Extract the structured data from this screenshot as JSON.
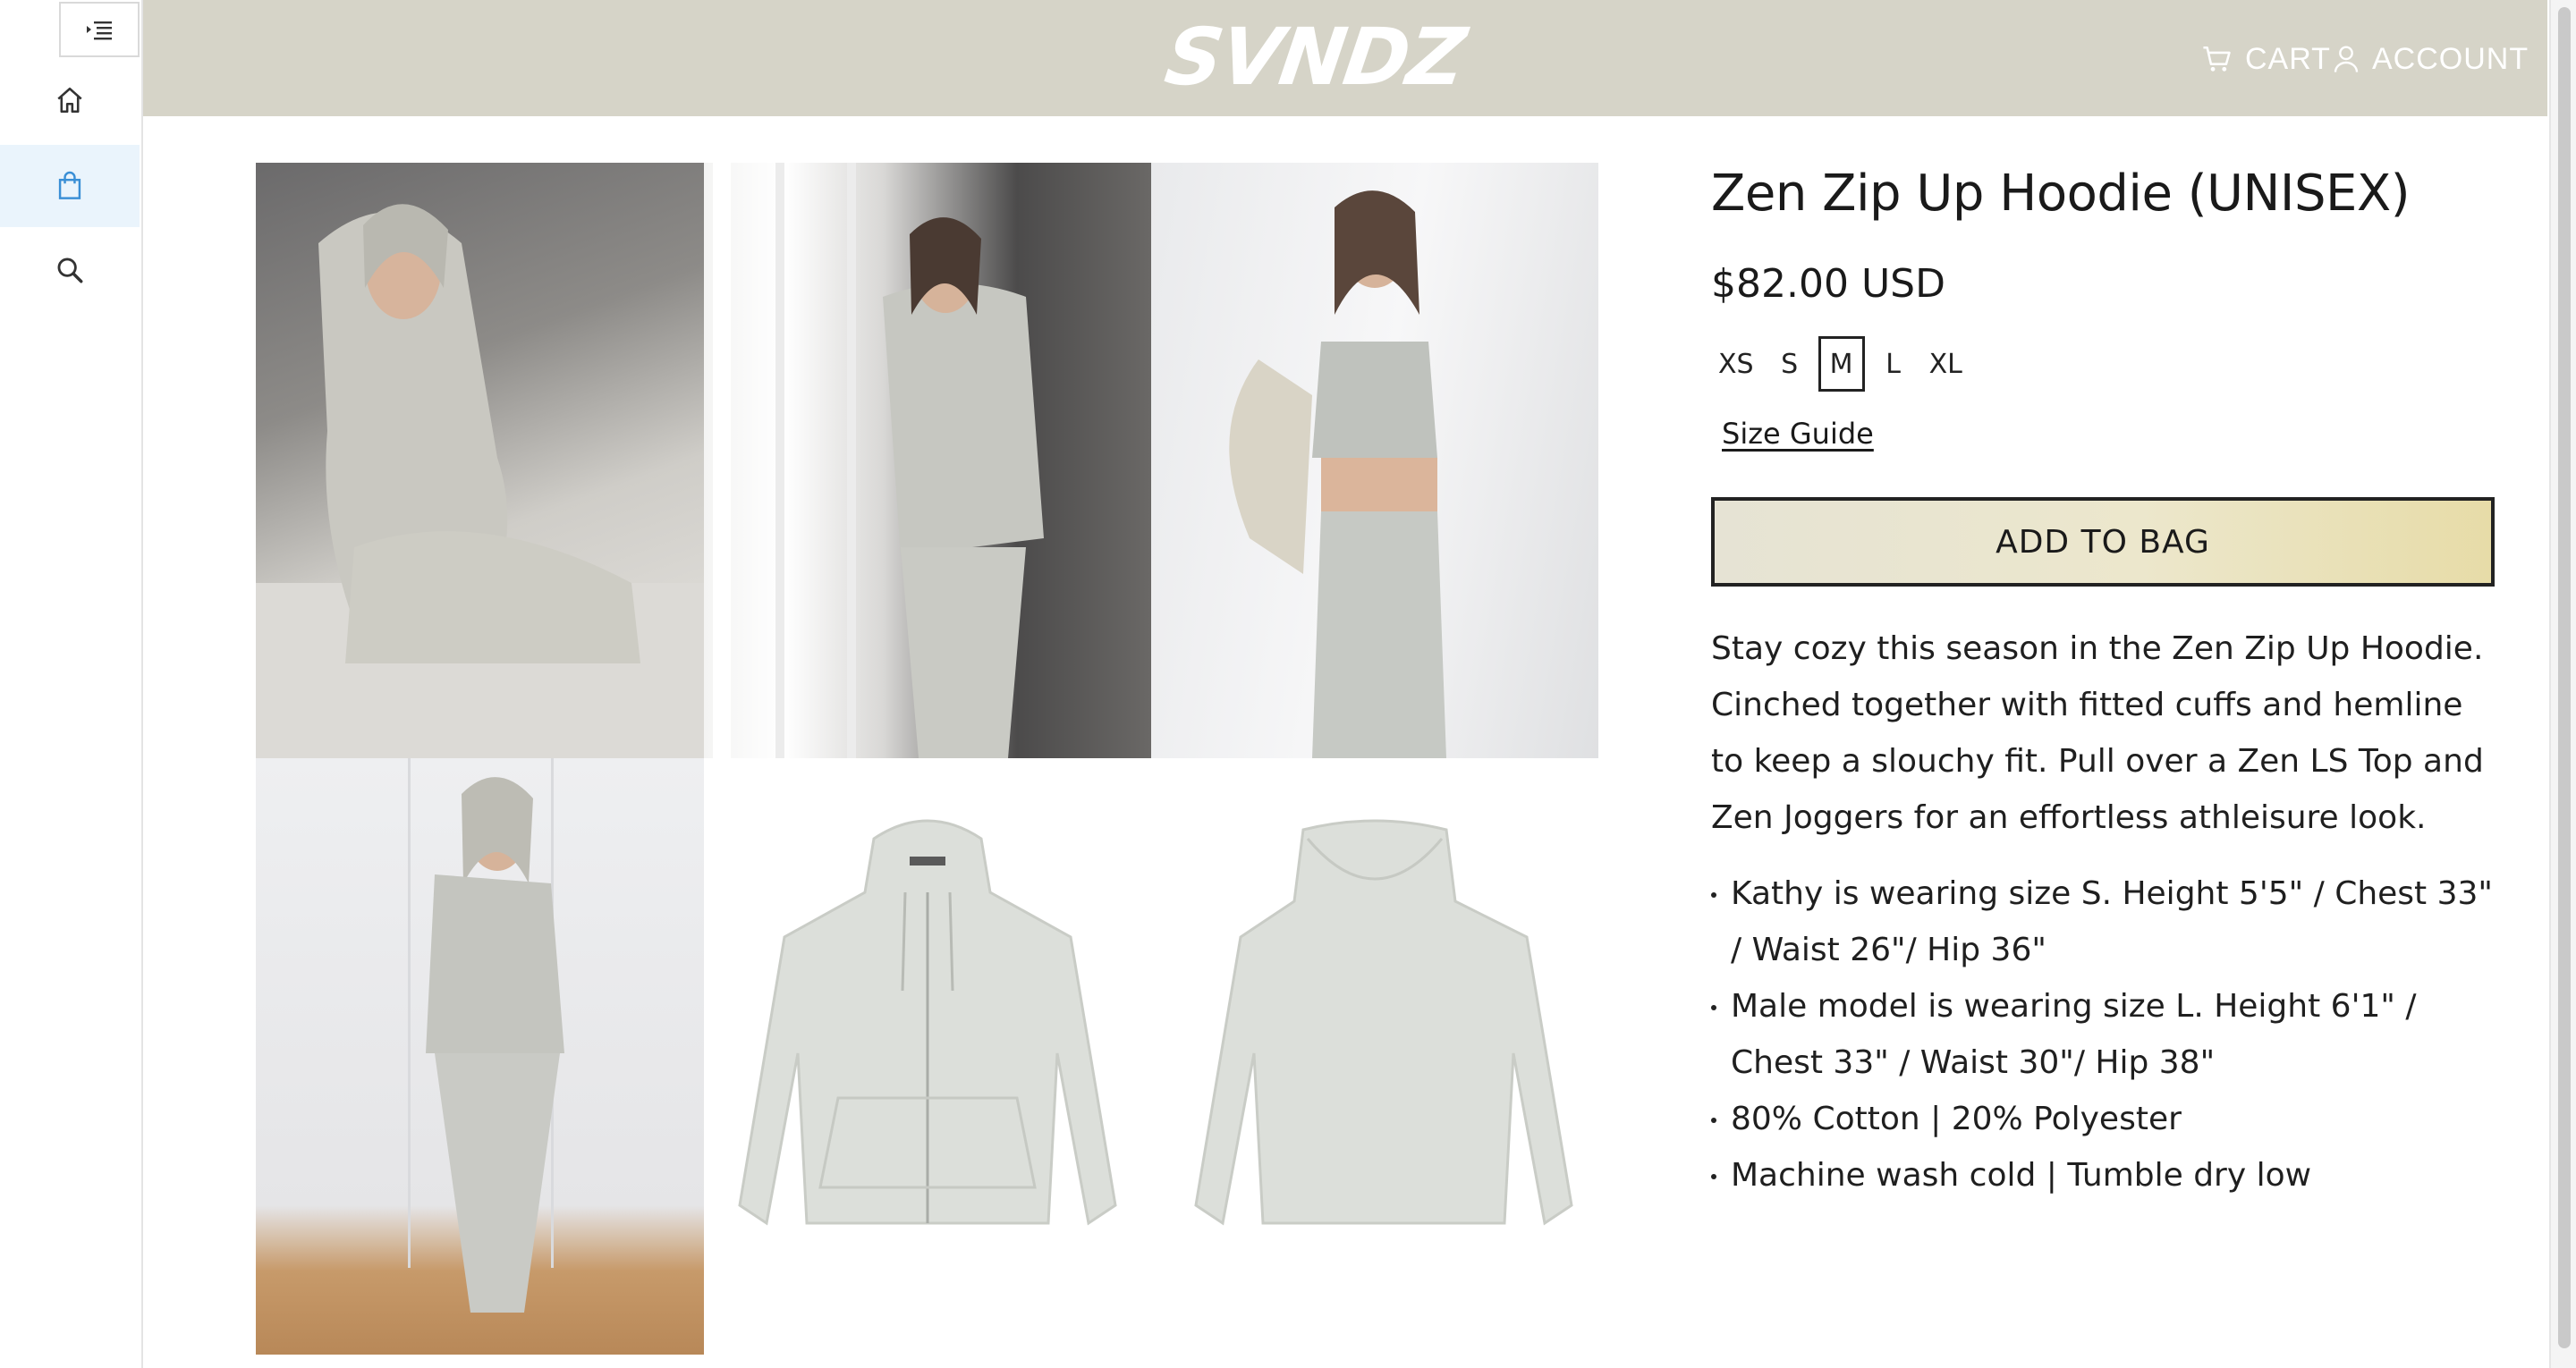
{
  "sidebar": {
    "toggle_icon": "indent-menu-icon",
    "items": [
      {
        "icon": "home-icon",
        "active": false
      },
      {
        "icon": "shopping-bag-icon",
        "active": true
      },
      {
        "icon": "search-icon",
        "active": false
      }
    ]
  },
  "header": {
    "logo_text": "SVNDZ",
    "cart_label": "CART",
    "account_label": "ACCOUNT",
    "background_color": "#d6d4c8"
  },
  "gallery": {
    "images": [
      {
        "name": "model-sitting-photo"
      },
      {
        "name": "model-window-photo"
      },
      {
        "name": "model-wall-photo"
      },
      {
        "name": "model-standing-photo"
      },
      {
        "name": "hoodie-front-photo"
      },
      {
        "name": "hoodie-back-photo"
      }
    ]
  },
  "product": {
    "title": "Zen Zip Up Hoodie (UNISEX)",
    "price": "$82.00 USD",
    "sizes": [
      "XS",
      "S",
      "M",
      "L",
      "XL"
    ],
    "selected_size": "M",
    "size_guide_label": "Size Guide",
    "add_to_bag_label": "ADD TO BAG",
    "description": "Stay cozy this season in the Zen Zip Up Hoodie. Cinched together with fitted cuffs and hemline to keep a slouchy fit. Pull over a Zen LS Top and Zen Joggers for an effortless athleisure look.",
    "bullets": [
      "Kathy is wearing size S. Height 5'5\" / Chest 33\" / Waist 26\"/ Hip 36\"",
      "Male model is wearing size L. Height 6'1\" / Chest 33\" / Waist 30\"/ Hip 38\"",
      "80% Cotton | 20% Polyester",
      "Machine wash cold | Tumble dry low"
    ]
  }
}
